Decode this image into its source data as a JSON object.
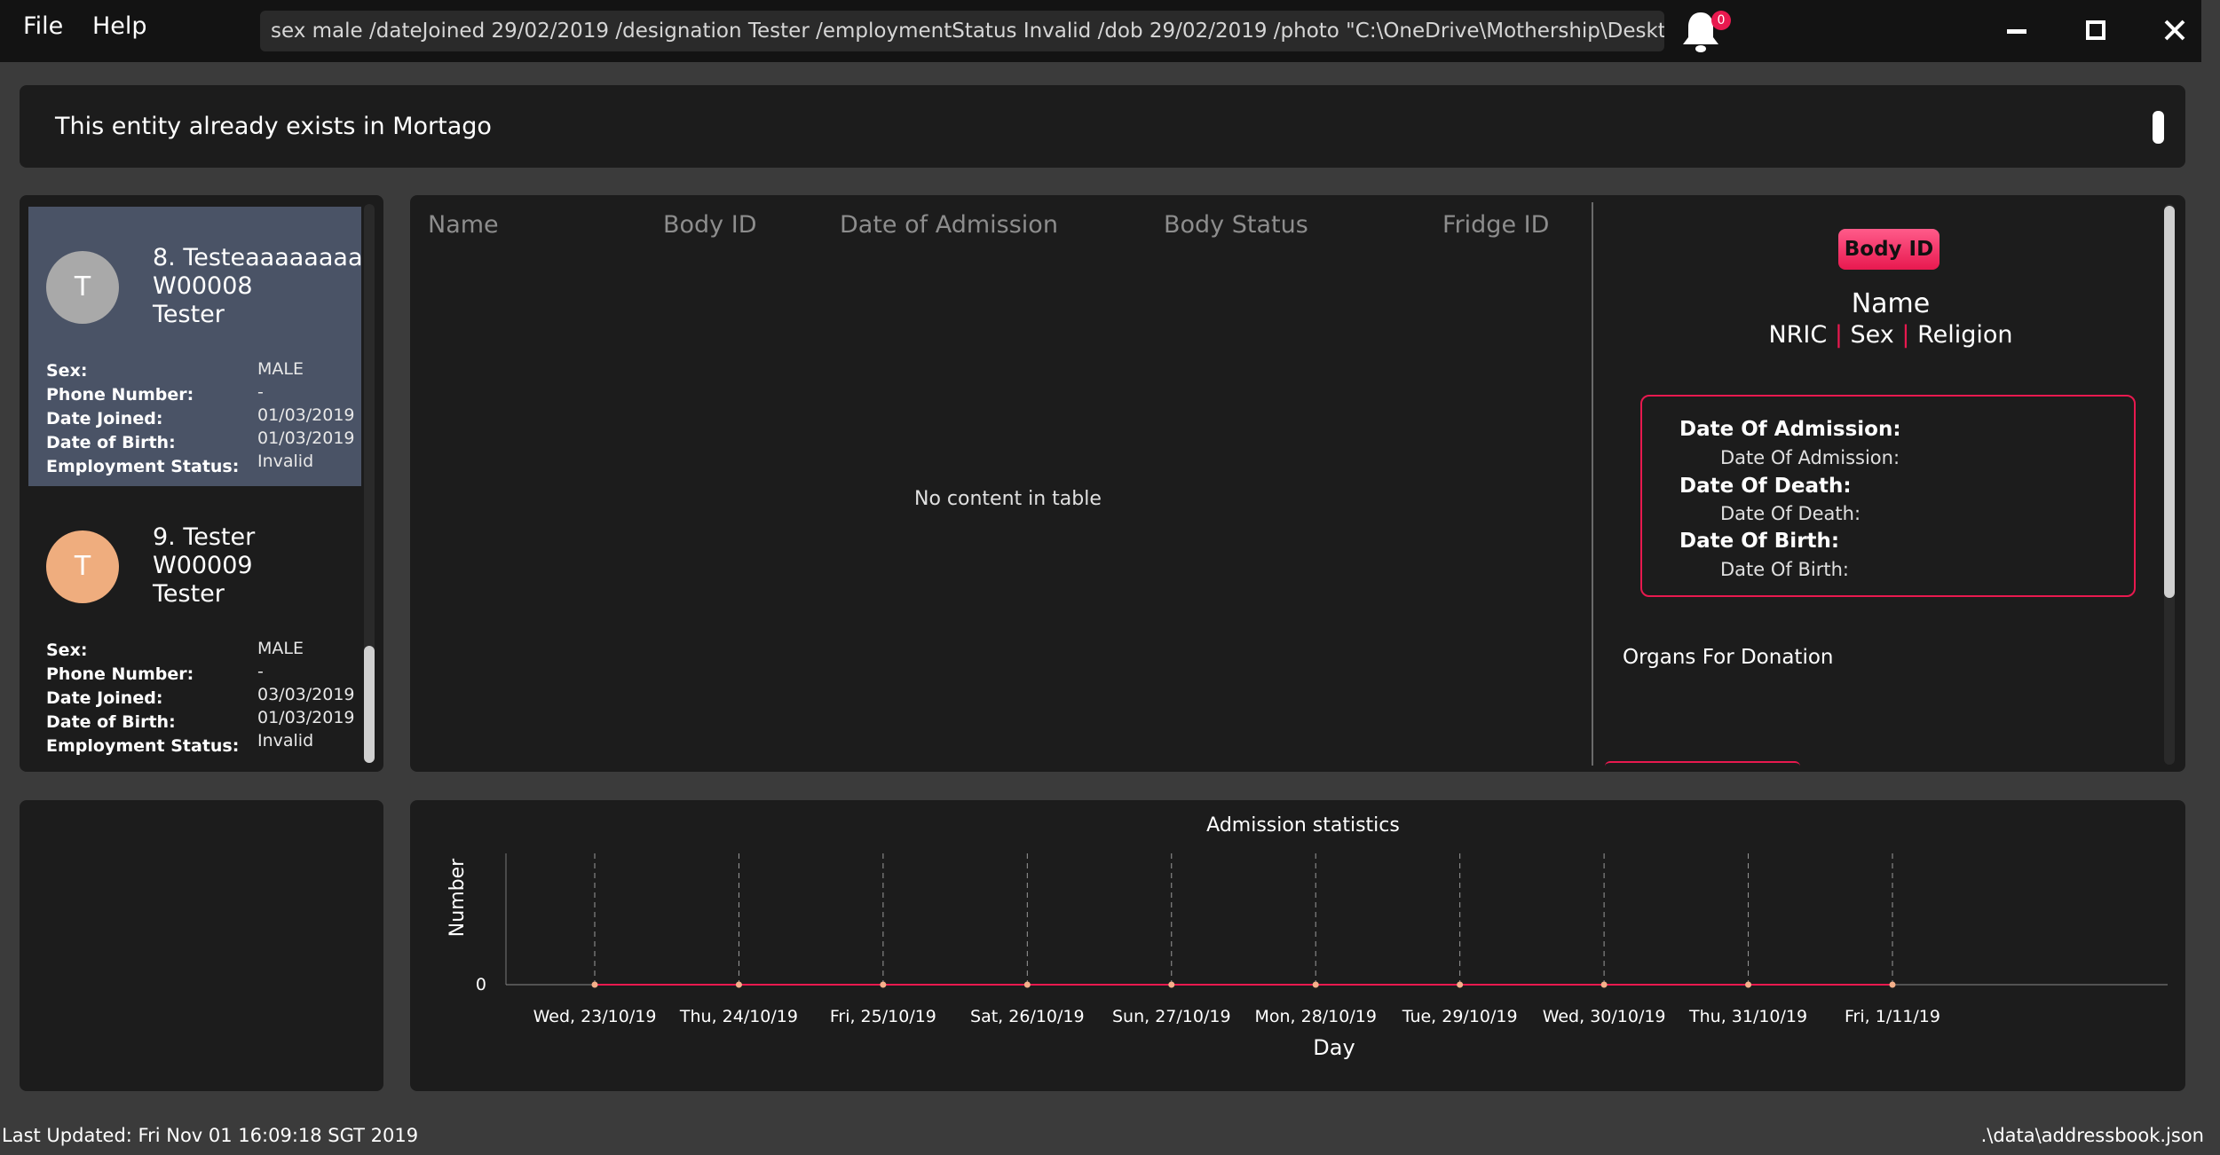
{
  "menu": {
    "file": "File",
    "help": "Help"
  },
  "command_input": {
    "value": "sex male /dateJoined 29/02/2019 /designation Tester /employmentStatus Invalid /dob 29/02/2019 /photo \"C:\\OneDrive\\Mothership\\Desktop\\Info.png\""
  },
  "notifications": {
    "count": "0",
    "icon": "bell-icon"
  },
  "window_controls": [
    "minimize-icon",
    "maximize-icon",
    "close-icon"
  ],
  "result_message": "This entity already exists in Mortago",
  "workers": [
    {
      "title": "8. Testeaaaaaaaa",
      "id": "W00008",
      "designation": "Tester",
      "avatar": "T",
      "avatar_color": "#a9a9a9",
      "fields": [
        {
          "label": "Sex:",
          "value": "MALE"
        },
        {
          "label": "Phone Number:",
          "value": "-"
        },
        {
          "label": "Date Joined:",
          "value": "01/03/2019"
        },
        {
          "label": "Date of Birth:",
          "value": "01/03/2019"
        },
        {
          "label": "Employment Status:",
          "value": "Invalid"
        }
      ]
    },
    {
      "title": "9. Tester",
      "id": "W00009",
      "designation": "Tester",
      "avatar": "T",
      "avatar_color": "#efad7e",
      "fields": [
        {
          "label": "Sex:",
          "value": "MALE"
        },
        {
          "label": "Phone Number:",
          "value": "-"
        },
        {
          "label": "Date Joined:",
          "value": "03/03/2019"
        },
        {
          "label": "Date of Birth:",
          "value": "01/03/2019"
        },
        {
          "label": "Employment Status:",
          "value": "Invalid"
        }
      ]
    }
  ],
  "table": {
    "headers": [
      "Name",
      "Body ID",
      "Date of Admission",
      "Body Status",
      "Fridge ID"
    ],
    "empty_text": "No content in table"
  },
  "detail": {
    "badge": "Body ID",
    "name": "Name",
    "nric": "NRIC",
    "sex": "Sex",
    "religion": "Religion",
    "separator": "|",
    "dates": [
      {
        "label": "Date Of Admission:",
        "value": "Date Of Admission:"
      },
      {
        "label": "Date Of Death:",
        "value": "Date Of Death:"
      },
      {
        "label": "Date Of Birth:",
        "value": "Date Of Birth:"
      }
    ],
    "organs_label": "Organs For Donation"
  },
  "chart_data": {
    "type": "line",
    "title": "Admission statistics",
    "xlabel": "Day",
    "ylabel": "Number",
    "categories": [
      "Wed, 23/10/19",
      "Thu, 24/10/19",
      "Fri, 25/10/19",
      "Sat, 26/10/19",
      "Sun, 27/10/19",
      "Mon, 28/10/19",
      "Tue, 29/10/19",
      "Wed, 30/10/19",
      "Thu, 31/10/19",
      "Fri, 1/11/19"
    ],
    "values": [
      0,
      0,
      0,
      0,
      0,
      0,
      0,
      0,
      0,
      0
    ],
    "y_ticks": [
      "0"
    ],
    "ylim": [
      0,
      1
    ],
    "grid": "vertical-dashed",
    "line_color": "#e8194f",
    "point_color": "#f5b08a"
  },
  "status": {
    "last_updated": "Last Updated: Fri Nov 01 16:09:18 SGT 2019",
    "path": ".\\data\\addressbook.json"
  },
  "colors": {
    "accent": "#e8194f",
    "selected_card": "#4a5366",
    "panel": "#1c1c1c"
  }
}
